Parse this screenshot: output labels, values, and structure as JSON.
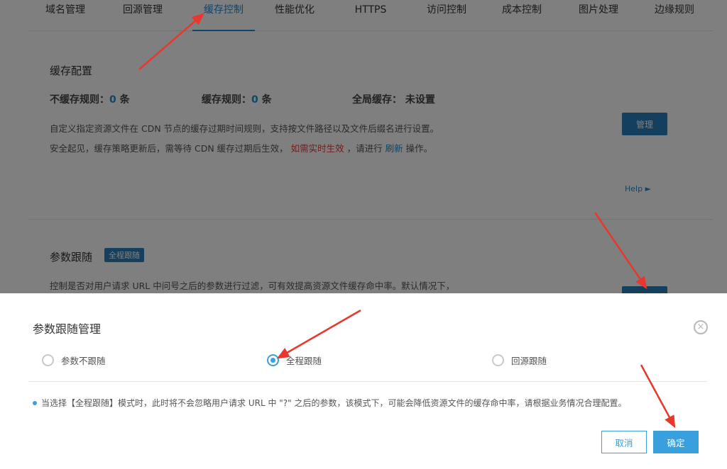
{
  "tabs": [
    {
      "label": "域名管理"
    },
    {
      "label": "回源管理"
    },
    {
      "label": "缓存控制"
    },
    {
      "label": "性能优化"
    },
    {
      "label": "HTTPS"
    },
    {
      "label": "访问控制"
    },
    {
      "label": "成本控制"
    },
    {
      "label": "图片处理"
    },
    {
      "label": "边缘规则"
    }
  ],
  "active_tab": "缓存控制",
  "cache_config": {
    "title": "缓存配置",
    "no_cache_label": "不缓存规则：",
    "no_cache_count": "0",
    "no_cache_unit": "条",
    "cache_label": "缓存规则：",
    "cache_count": "0",
    "cache_unit": "条",
    "global_label": "全局缓存：",
    "global_value": "未设置",
    "desc1": "自定义指定资源文件在 CDN 节点的缓存过期时间规则，支持按文件路径以及文件后缀名进行设置。",
    "desc2_a": "安全起见，缓存策略更新后，需等待 CDN 缓存过期后生效，",
    "desc2_red": "如需实时生效",
    "desc2_b": "，请进行",
    "desc2_link": "刷新",
    "desc2_c": "操作。",
    "manage_label": "管理",
    "help_label": "Help ►"
  },
  "param_follow": {
    "title": "参数跟随",
    "badge": "全程跟随",
    "desc": "控制是否对用户请求 URL 中问号之后的参数进行过滤，可有效提高资源文件缓存命中率。默认情况下，"
  },
  "modal": {
    "title": "参数跟随管理",
    "close_glyph": "×",
    "options": [
      {
        "label": "参数不跟随",
        "checked": false
      },
      {
        "label": "全程跟随",
        "checked": true
      },
      {
        "label": "回源跟随",
        "checked": false
      }
    ],
    "notice": "当选择【全程跟随】模式时，此时将不会忽略用户请求 URL 中 \"?\" 之后的参数，该模式下，可能会降低资源文件的缓存命中率，请根据业务情况合理配置。",
    "cancel_label": "取消",
    "ok_label": "确定"
  },
  "colors": {
    "accent": "#1f8ad1",
    "button": "#2b80ba",
    "modal_accent": "#3aa0dd",
    "warning": "#e23b3b",
    "annotation_arrow": "#e8372c"
  }
}
